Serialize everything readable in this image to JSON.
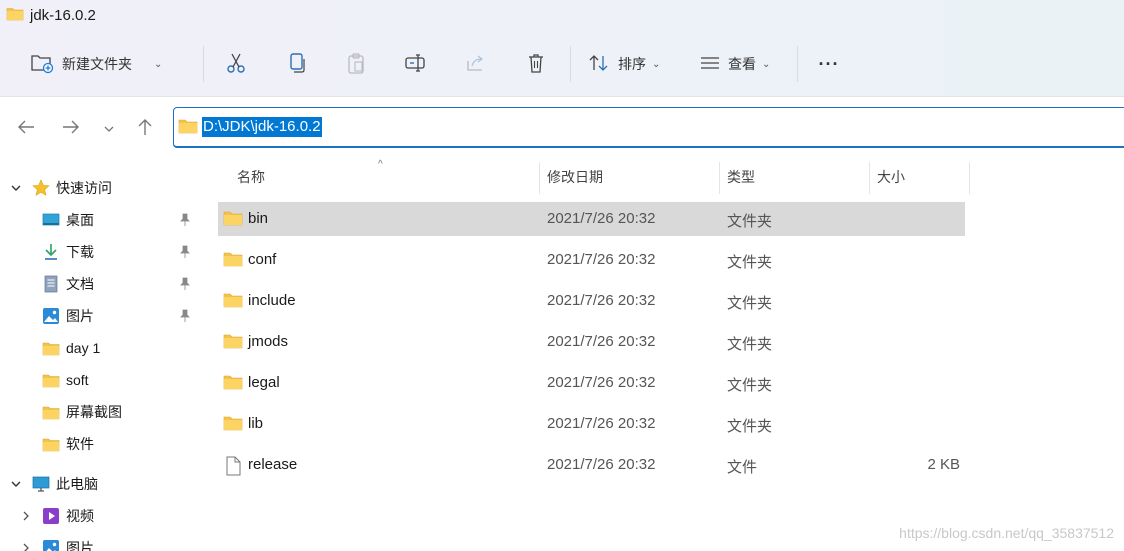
{
  "window": {
    "title": "jdk-16.0.2"
  },
  "toolbar": {
    "new_folder_label": "新建文件夹",
    "sort_label": "排序",
    "view_label": "查看",
    "more_label": "···"
  },
  "address": {
    "path": "D:\\JDK\\jdk-16.0.2"
  },
  "sidebar": {
    "items": [
      {
        "label": "快速访问",
        "icon": "star-icon"
      },
      {
        "label": "桌面",
        "icon": "desktop-icon"
      },
      {
        "label": "下载",
        "icon": "download-icon"
      },
      {
        "label": "文档",
        "icon": "document-icon"
      },
      {
        "label": "图片",
        "icon": "pictures-icon"
      },
      {
        "label": "day 1",
        "icon": "folder-icon"
      },
      {
        "label": "soft",
        "icon": "folder-icon"
      },
      {
        "label": "屏幕截图",
        "icon": "folder-icon"
      },
      {
        "label": "软件",
        "icon": "folder-icon"
      },
      {
        "label": "此电脑",
        "icon": "computer-icon"
      },
      {
        "label": "视频",
        "icon": "video-icon"
      },
      {
        "label": "图片",
        "icon": "pictures-icon"
      }
    ]
  },
  "columns": {
    "name": "名称",
    "modified": "修改日期",
    "type": "类型",
    "size": "大小"
  },
  "files": [
    {
      "name": "bin",
      "date": "2021/7/26 20:32",
      "type": "文件夹",
      "size": ""
    },
    {
      "name": "conf",
      "date": "2021/7/26 20:32",
      "type": "文件夹",
      "size": ""
    },
    {
      "name": "include",
      "date": "2021/7/26 20:32",
      "type": "文件夹",
      "size": ""
    },
    {
      "name": "jmods",
      "date": "2021/7/26 20:32",
      "type": "文件夹",
      "size": ""
    },
    {
      "name": "legal",
      "date": "2021/7/26 20:32",
      "type": "文件夹",
      "size": ""
    },
    {
      "name": "lib",
      "date": "2021/7/26 20:32",
      "type": "文件夹",
      "size": ""
    },
    {
      "name": "release",
      "date": "2021/7/26 20:32",
      "type": "文件",
      "size": "2 KB"
    }
  ],
  "watermark": "https://blog.csdn.net/qq_35837512",
  "colors": {
    "accent": "#0078d4",
    "folder": "#f5c34a",
    "selection": "#d9d9d9"
  }
}
